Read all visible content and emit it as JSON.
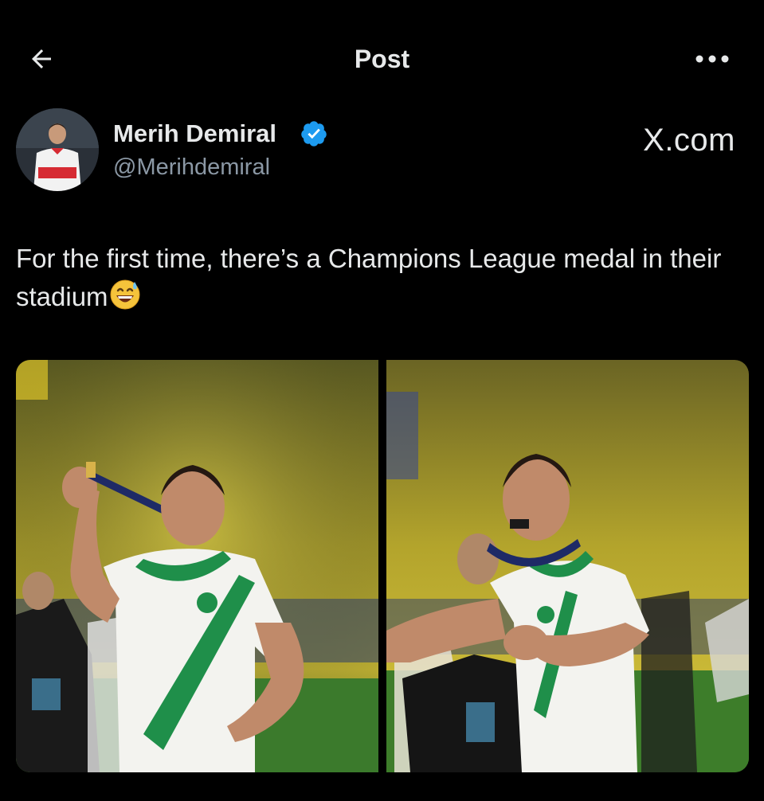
{
  "header": {
    "title": "Post",
    "back_icon": "arrow-left-icon",
    "more_icon": "more-horizontal-icon"
  },
  "author": {
    "name": "Merih Demiral",
    "handle": "@Merihdemiral",
    "verified": true,
    "verified_color": "#1d9bf0"
  },
  "watermark": "X.com",
  "post": {
    "text": "For the first time, there’s a Champions League medal in their stadium",
    "emoji": "grinning-face-with-sweat-icon"
  },
  "media": {
    "photos": [
      {
        "label": "photo-1"
      },
      {
        "label": "photo-2"
      }
    ]
  },
  "colors": {
    "background": "#000000",
    "text": "#e7e9ea",
    "secondary_text": "#8b98a5",
    "jersey_green": "#1f8f4a",
    "crowd_yellow": "#c9b52a"
  }
}
